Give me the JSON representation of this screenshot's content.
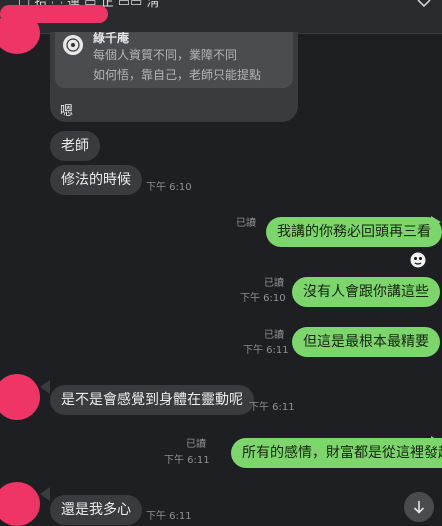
{
  "header": {
    "title": "▢ 拾 ◌ 蓮 ▭ 正 ▭▭ 淸",
    "icons": {
      "collapse": "chevron-down-icon"
    }
  },
  "quoted_message": {
    "sender": "綠千庵",
    "line1": "每個人資質不同，業障不同",
    "line2": "如何悟，靠自己，老師只能提點",
    "reply_text": "嗯"
  },
  "messages": [
    {
      "text": "老師",
      "side": "in"
    },
    {
      "text": "修法的時候",
      "side": "in",
      "time": "下午 6:10"
    },
    {
      "text": "我講的你務必回頭再三看",
      "side": "out",
      "read": "已讀"
    },
    {
      "text": "沒有人會跟你講這些",
      "side": "out",
      "read": "已讀",
      "time": "下午 6:10"
    },
    {
      "text": "但這是最根本最精要",
      "side": "out",
      "read": "已讀",
      "time": "下午 6:11"
    },
    {
      "text": "是不是會感覺到身體在靈動呢",
      "side": "in",
      "time": "下午 6:11"
    },
    {
      "text": "所有的感情，財富都是從這裡發起",
      "side": "out",
      "read": "已讀",
      "time": "下午 6:11"
    },
    {
      "text": "還是我多心",
      "side": "in",
      "time": "下午 6:11"
    }
  ],
  "colors": {
    "background": "#1e1f22",
    "incoming_bubble": "#3a3b3f",
    "outgoing_bubble": "#7cd66b",
    "redaction": "#ee3566"
  },
  "controls": {
    "scroll_to_bottom_icon": "arrow-down-icon"
  }
}
